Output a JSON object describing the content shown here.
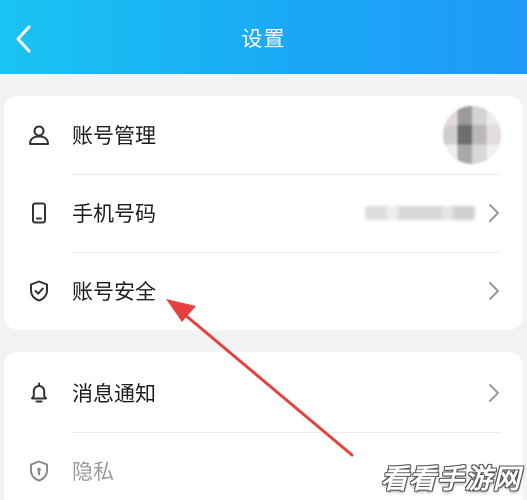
{
  "header": {
    "title": "设置"
  },
  "group1": {
    "items": [
      {
        "label": "账号管理",
        "icon": "user-icon"
      },
      {
        "label": "手机号码",
        "icon": "phone-icon"
      },
      {
        "label": "账号安全",
        "icon": "shield-icon"
      }
    ]
  },
  "group2": {
    "items": [
      {
        "label": "消息通知",
        "icon": "bell-icon"
      },
      {
        "label": "隐私",
        "icon": "privacy-shield-icon"
      }
    ]
  },
  "watermark": {
    "text": "看看手游网"
  },
  "colors": {
    "header_start": "#1ac4f2",
    "header_end": "#1f9af6",
    "annotation_arrow": "#e5413f"
  }
}
